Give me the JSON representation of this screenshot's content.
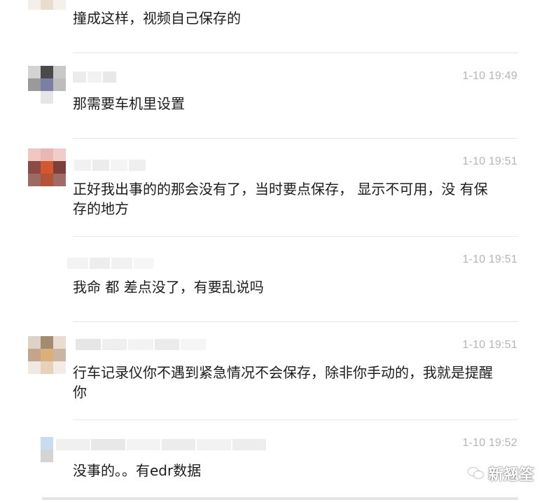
{
  "comments": [
    {
      "text": "撞成这样，视频自己保存的",
      "time": "",
      "avatar_colors": [
        "#f0ece6",
        "#d9c9b4",
        "#efe4d6",
        "#f4efe9",
        "#e9dccb",
        "#f5f0ea",
        "#ffffff",
        "#ffffff",
        "#ffffff"
      ],
      "name_blur_colors": []
    },
    {
      "text": "那需要车机里设置",
      "time": "1-10 19:49",
      "avatar_colors": [
        "#d3d3d3",
        "#4a4a4a",
        "#c8c8c8",
        "#9a9a9a",
        "#7a7fa3",
        "#bdbdbd",
        "#ffffff",
        "#e6e6e6",
        "#ffffff"
      ],
      "name_blur_colors": [
        "#ececec",
        "#f2f2f2",
        "#e8e8e8"
      ]
    },
    {
      "text": "正好我出事的的那会没有了，当时要点保存， 显示不可用，没 有保存的地方",
      "time": "1-10 19:51",
      "avatar_colors": [
        "#f2c6c0",
        "#e7b8b2",
        "#f0cdc8",
        "#8a4b45",
        "#d2592f",
        "#7c3f3a",
        "#9c6a62",
        "#b5523a",
        "#a06b64"
      ],
      "name_blur_colors": [
        "#f1f1f1",
        "#ececec",
        "#f4f4f4",
        "#efefef"
      ]
    },
    {
      "text": "我命 都 差点没了，有要乱说吗",
      "time": "1-10 19:51",
      "avatar_colors": [
        "#ffffff",
        "#ffffff",
        "#ffffff",
        "#ffffff",
        "#ffffff",
        "#ffffff",
        "#ffffff",
        "#ffffff",
        "#ffffff"
      ],
      "name_blur_colors": [
        "#f3f3f3",
        "#ededed",
        "#f1f1f1",
        "#f6f6f6"
      ]
    },
    {
      "text": "行车记录仪你不遇到紧急情况不会保存，除非你手动的，我就是提醒你",
      "time": "1-10 19:51",
      "avatar_colors": [
        "#dcd2c6",
        "#a48a6f",
        "#e8ddd0",
        "#c2a58a",
        "#d9b07a",
        "#cbb4a2",
        "#f0e9e1",
        "#e6d2bb",
        "#f3ece4"
      ],
      "name_blur_colors": [
        "#e6e6e6",
        "#efefef",
        "#f3f3f3",
        "#ebebeb",
        "#f5f5f5"
      ]
    },
    {
      "text": "没事的。。有edr数据",
      "time": "1-10 19:52",
      "avatar_colors": [
        "#ffffff",
        "#c9dbee",
        "#ffffff",
        "#ffffff",
        "#d4d4d4",
        "#ffffff",
        "#ffffff",
        "#ffffff",
        "#ffffff"
      ],
      "name_blur_colors": [
        "#f0f0f0",
        "#e8e8e8",
        "#f3f3f3",
        "#ececec",
        "#f2f2f2",
        "#ededed"
      ]
    }
  ],
  "watermark": {
    "text": "新翘筌",
    "icon": "wechat-icon"
  }
}
